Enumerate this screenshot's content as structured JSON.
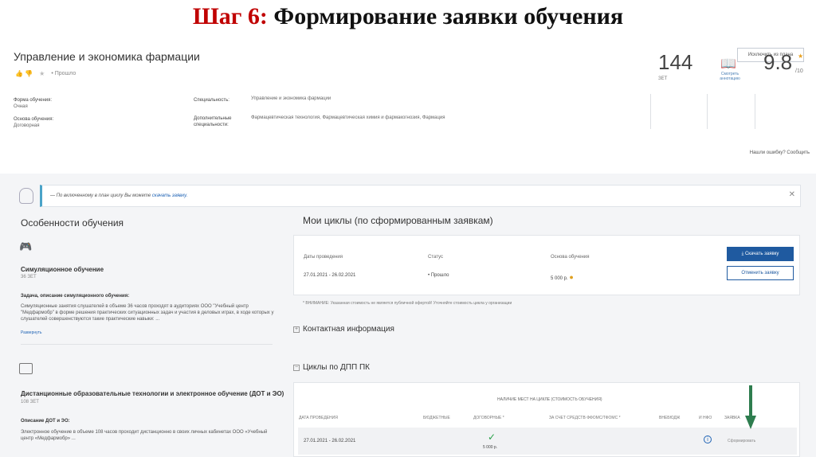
{
  "slide": {
    "prefix": "Шаг 6:",
    "title": " Формирование заявки обучения"
  },
  "course": {
    "name": "Управление и экономика фармации",
    "status": "Прошло",
    "exclude_button": "Исключить из плана",
    "form_label": "Форма обучения:",
    "form_value": "Очная",
    "basis_label": "Основа обучения:",
    "basis_value": "Договорная",
    "spec_label": "Специальность:",
    "spec_value": "Управление и экономика фармации",
    "extra_spec_label": "Дополнительные специальности:",
    "extra_spec_value": "Фармацевтическая технология, Фармацевтическая химия и фармакогнозия, Фармация",
    "zet_value": "144",
    "zet_label": "ЗЕТ",
    "book_label": "Смотреть аннотацию",
    "rating_value": "9.8",
    "rating_of": "/10",
    "error_link": "Нашли ошибку? Сообщить"
  },
  "notice": {
    "text": "— По включенному в план циклу Вы можете ",
    "link": "скачать заявку."
  },
  "features": {
    "title": "Особенности обучения",
    "sim_title": "Симуляционное обучение",
    "sim_zet": "36 ЗЕТ",
    "task_title": "Задача, описание симуляционного обучения:",
    "task_body": "Симуляционные занятия слушателей в объеме 36 часов проходят в аудиториях ООО \"Учебный центр \"Медфармобр\" в форме решения практических ситуационных задач и участия в деловых играх, в ходе которых у слушателей совершенствуются такие практические навыки: ...",
    "expand": "Развернуть",
    "dot_title": "Дистанционные образовательные технологии и электронное обучение (ДОТ и ЭО)",
    "dot_zet": "108 ЗЕТ",
    "dot_desc_title": "Описание ДОТ и ЭО:",
    "dot_desc": "Электронное обучение в объеме 108 часов проходит дистанционно в своих личных кабинетах ООО «Учебный центр «Медфармобр» ..."
  },
  "my_cycles": {
    "title": "Мои циклы (по сформированным заявкам)",
    "col_dates": "Даты проведения",
    "col_status": "Статус",
    "col_basis": "Основа обучения",
    "dates": "27.01.2021 - 26.02.2021",
    "status": "• Прошло",
    "price": "5 000 р.",
    "download_button": "⤓ Скачать заявку",
    "cancel_button": "Отменить заявку",
    "warning": "* ВНИМАНИЕ: Указанная стоимость не является публичной офертой! Уточняйте стоимость цикла у организации"
  },
  "contact": {
    "title": "Контактная информация"
  },
  "dpp": {
    "title": "Циклы по ДПП ПК",
    "group_header": "НАЛИЧИЕ МЕСТ НА ЦИКЛЕ (СТОИМОСТЬ ОБУЧЕНИЯ)",
    "headers": [
      "ДАТА ПРОВЕДЕНИЯ",
      "БЮДЖЕТНЫЕ",
      "ДОГОВОРНЫЕ *",
      "ЗА СЧЕТ СРЕДСТВ ФФОМС/ТФОМС *",
      "ВНЕБЮДЖ",
      "И НФО",
      "ЗАЯВКА"
    ],
    "row": {
      "dates": "27.01.2021 - 26.02.2021",
      "price": "5 000 р.",
      "request": "Сформировать"
    }
  },
  "colors": {
    "accent": "#c00000",
    "primary": "#1f5aa0",
    "check": "#2aa24a",
    "arrow": "#2e7d4f"
  }
}
